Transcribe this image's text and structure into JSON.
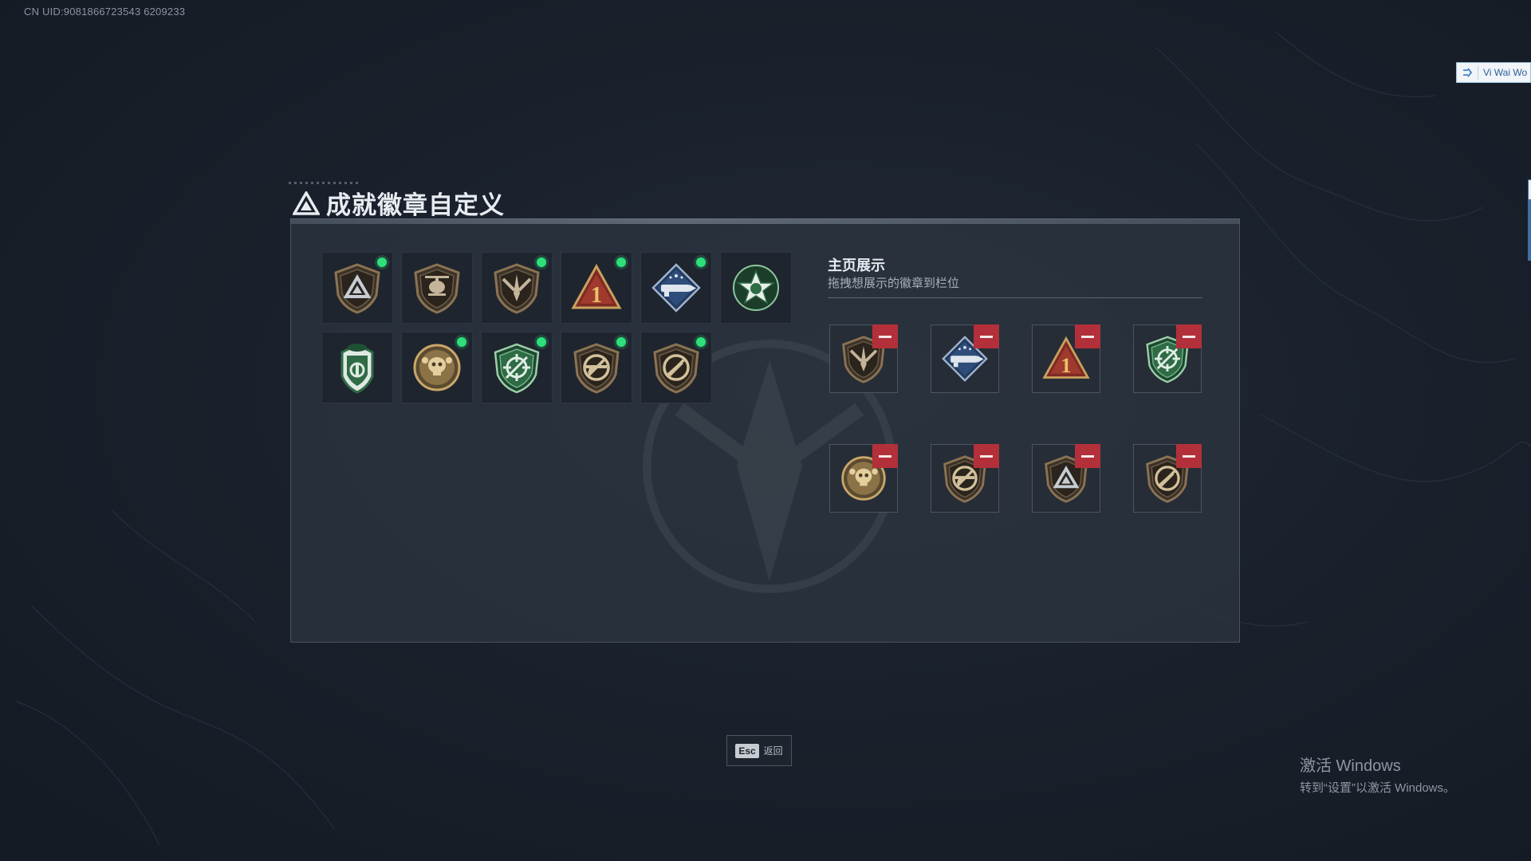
{
  "header": {
    "uid": "CN UID:9081866723543 6209233",
    "title": "成就徽章自定义"
  },
  "side_tag": {
    "label": "Vi Wai Wo",
    "icon": "exit-icon"
  },
  "badges": [
    {
      "emblem": "triangle-shield",
      "new": true
    },
    {
      "emblem": "helicopter-shield",
      "new": false
    },
    {
      "emblem": "dagger-shield",
      "new": true
    },
    {
      "emblem": "number-one-triangle",
      "new": true,
      "number": "1"
    },
    {
      "emblem": "rocket-diamond",
      "new": true
    },
    {
      "emblem": "green-star-wreath",
      "new": false
    },
    {
      "emblem": "green-soldier-shield",
      "new": false
    },
    {
      "emblem": "gold-skull-coin",
      "new": true
    },
    {
      "emblem": "green-crosshair-shield",
      "new": true
    },
    {
      "emblem": "rifle-no-shield",
      "new": true
    },
    {
      "emblem": "knife-no-shield",
      "new": true
    }
  ],
  "showcase": {
    "title": "主页展示",
    "subtitle": "拖拽想展示的徽章到栏位",
    "slots": [
      {
        "emblem": "dagger-shield"
      },
      {
        "emblem": "rocket-diamond"
      },
      {
        "emblem": "number-one-triangle",
        "number": "1"
      },
      {
        "emblem": "green-crosshair-shield"
      },
      {
        "emblem": "gold-skull-coin"
      },
      {
        "emblem": "rifle-no-shield"
      },
      {
        "emblem": "triangle-shield"
      },
      {
        "emblem": "knife-no-shield"
      }
    ]
  },
  "footer": {
    "esc_key": "Esc",
    "esc_label": "返回"
  },
  "watermark": {
    "line1": "激活 Windows",
    "line2": "转到“设置”以激活 Windows。"
  },
  "colors": {
    "new_dot": "#2ee07c",
    "remove": "#b3303a",
    "bronze": "#8b7353",
    "green": "#2f6b45"
  }
}
